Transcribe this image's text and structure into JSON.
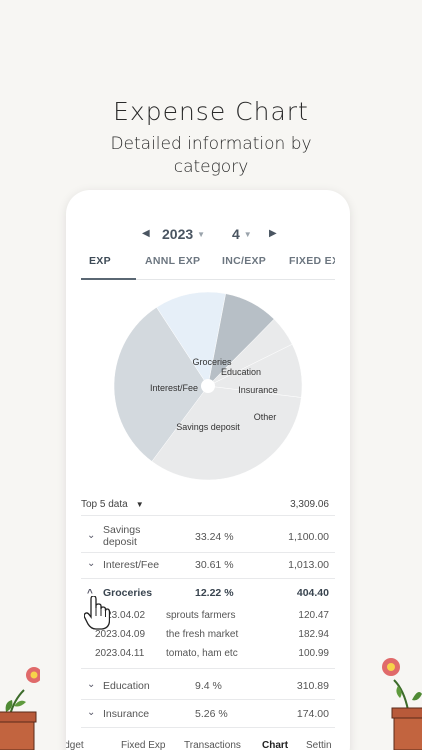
{
  "promo": {
    "title": "Expense Chart",
    "subtitle_line1": "Detailed information by",
    "subtitle_line2": "category"
  },
  "period": {
    "year": "2023",
    "month": "4"
  },
  "tabs": [
    {
      "label": "EXP",
      "active": true
    },
    {
      "label": "ANNL EXP",
      "active": false
    },
    {
      "label": "INC/EXP",
      "active": false
    },
    {
      "label": "FIXED EX",
      "active": false
    }
  ],
  "chart_data": {
    "type": "pie",
    "labels": [
      "Savings deposit",
      "Interest/Fee",
      "Groceries",
      "Education",
      "Insurance",
      "Other"
    ],
    "values": [
      33.24,
      30.61,
      12.22,
      9.4,
      5.26,
      9.27
    ],
    "colors": [
      "#e9eaeb",
      "#d3d9de",
      "#e6eff8",
      "#b7bfc6",
      "#e9eaeb",
      "#e9eaeb"
    ]
  },
  "top": {
    "selector": "Top 5 data",
    "total": "3,309.06"
  },
  "rows": [
    {
      "name_line1": "Savings",
      "name_line2": "deposit",
      "pct": "33.24 %",
      "amount": "1,100.00",
      "expanded": false
    },
    {
      "name_line1": "Interest/Fee",
      "name_line2": "",
      "pct": "30.61 %",
      "amount": "1,013.00",
      "expanded": false
    },
    {
      "name_line1": "Groceries",
      "name_line2": "",
      "pct": "12.22 %",
      "amount": "404.40",
      "expanded": true
    },
    {
      "name_line1": "Education",
      "name_line2": "",
      "pct": "9.4 %",
      "amount": "310.89",
      "expanded": false
    },
    {
      "name_line1": "Insurance",
      "name_line2": "",
      "pct": "5.26 %",
      "amount": "174.00",
      "expanded": false
    }
  ],
  "groceries_items": [
    {
      "date": "2023.04.02",
      "memo": "sprouts farmers",
      "amount": "120.47"
    },
    {
      "date": "2023.04.09",
      "memo": "the fresh market",
      "amount": "182.94"
    },
    {
      "date": "2023.04.11",
      "memo": "tomato, ham etc",
      "amount": "100.99"
    }
  ],
  "bottom_nav": [
    {
      "label": "Budget",
      "active": false
    },
    {
      "label": "Fixed Exp",
      "active": false
    },
    {
      "label": "Transactions",
      "active": false
    },
    {
      "label": "Chart",
      "active": true
    },
    {
      "label": "Settin",
      "active": false
    }
  ],
  "icons": {
    "prev": "chevron-left-icon",
    "next": "chevron-right-icon",
    "pointer": "hand-pointer-icon"
  }
}
